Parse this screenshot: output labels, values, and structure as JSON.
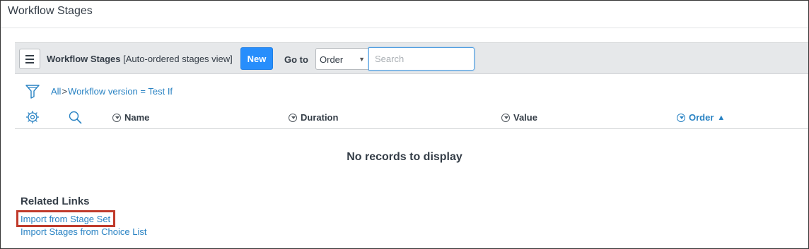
{
  "page": {
    "title": "Workflow Stages"
  },
  "toolbar": {
    "list_title": "Workflow Stages",
    "view_label": "[Auto-ordered stages view]",
    "new_label": "New",
    "goto_label": "Go to",
    "goto_selected": "Order",
    "search_placeholder": "Search",
    "search_value": ""
  },
  "breadcrumb": {
    "root": "All",
    "separator": ">",
    "filter": "Workflow version = Test If"
  },
  "columns": [
    {
      "label": "Name",
      "sorted": false
    },
    {
      "label": "Duration",
      "sorted": false
    },
    {
      "label": "Value",
      "sorted": false
    },
    {
      "label": "Order",
      "sorted": true,
      "sort_direction": "▲"
    }
  ],
  "table": {
    "empty_message": "No records to display"
  },
  "related_links": {
    "title": "Related Links",
    "items": [
      {
        "label": "Import from Stage Set",
        "highlighted": true
      },
      {
        "label": "Import Stages from Choice List",
        "highlighted": false
      }
    ]
  },
  "colors": {
    "accent": "#278efc",
    "link": "#2882c3",
    "highlight": "#c03a2b",
    "toolbar_bg": "#e6e8ea"
  },
  "icons": [
    "hamburger-menu-icon",
    "filter-icon",
    "gear-icon",
    "search-icon",
    "column-menu-icon",
    "sort-ascending-icon",
    "chevron-down-icon"
  ]
}
